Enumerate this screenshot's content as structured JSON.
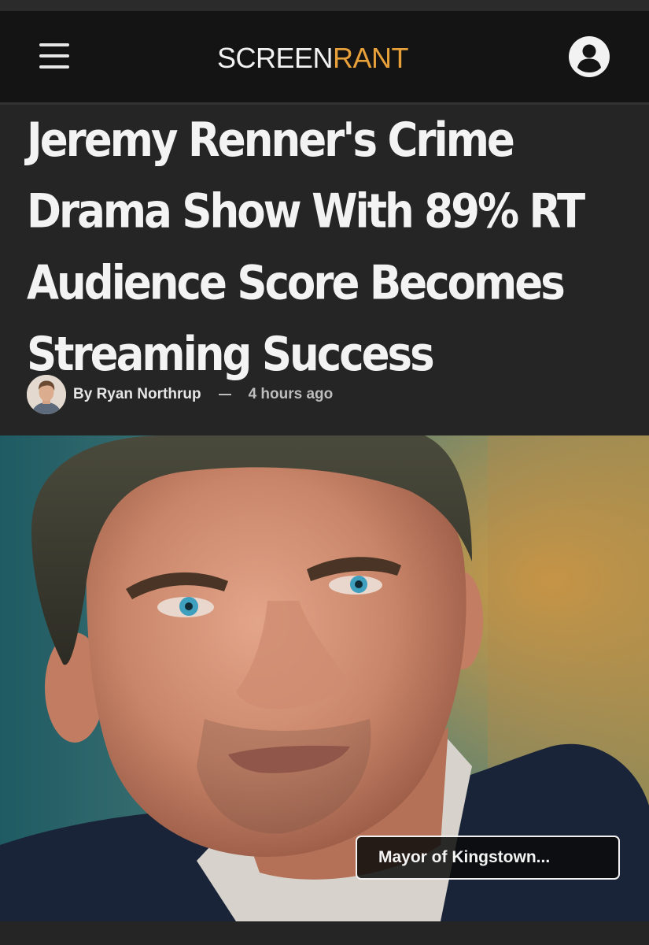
{
  "header": {
    "menu_icon": "hamburger-menu-icon",
    "logo": {
      "part1": "SCREEN",
      "part2": "RANT"
    },
    "account_icon": "user-account-icon"
  },
  "article": {
    "title": "Jeremy Renner's Crime Drama Show With 89% RT Audience Score Becomes Streaming Success",
    "byline": {
      "author": "By Ryan Northrup",
      "separator": "—",
      "time": "4 hours ago"
    },
    "hero": {
      "caption": "Mayor of Kingstown..."
    }
  },
  "colors": {
    "background": "#252525",
    "header": "#141414",
    "logo_accent": "#e8a13a",
    "text": "#f3f3f3"
  }
}
